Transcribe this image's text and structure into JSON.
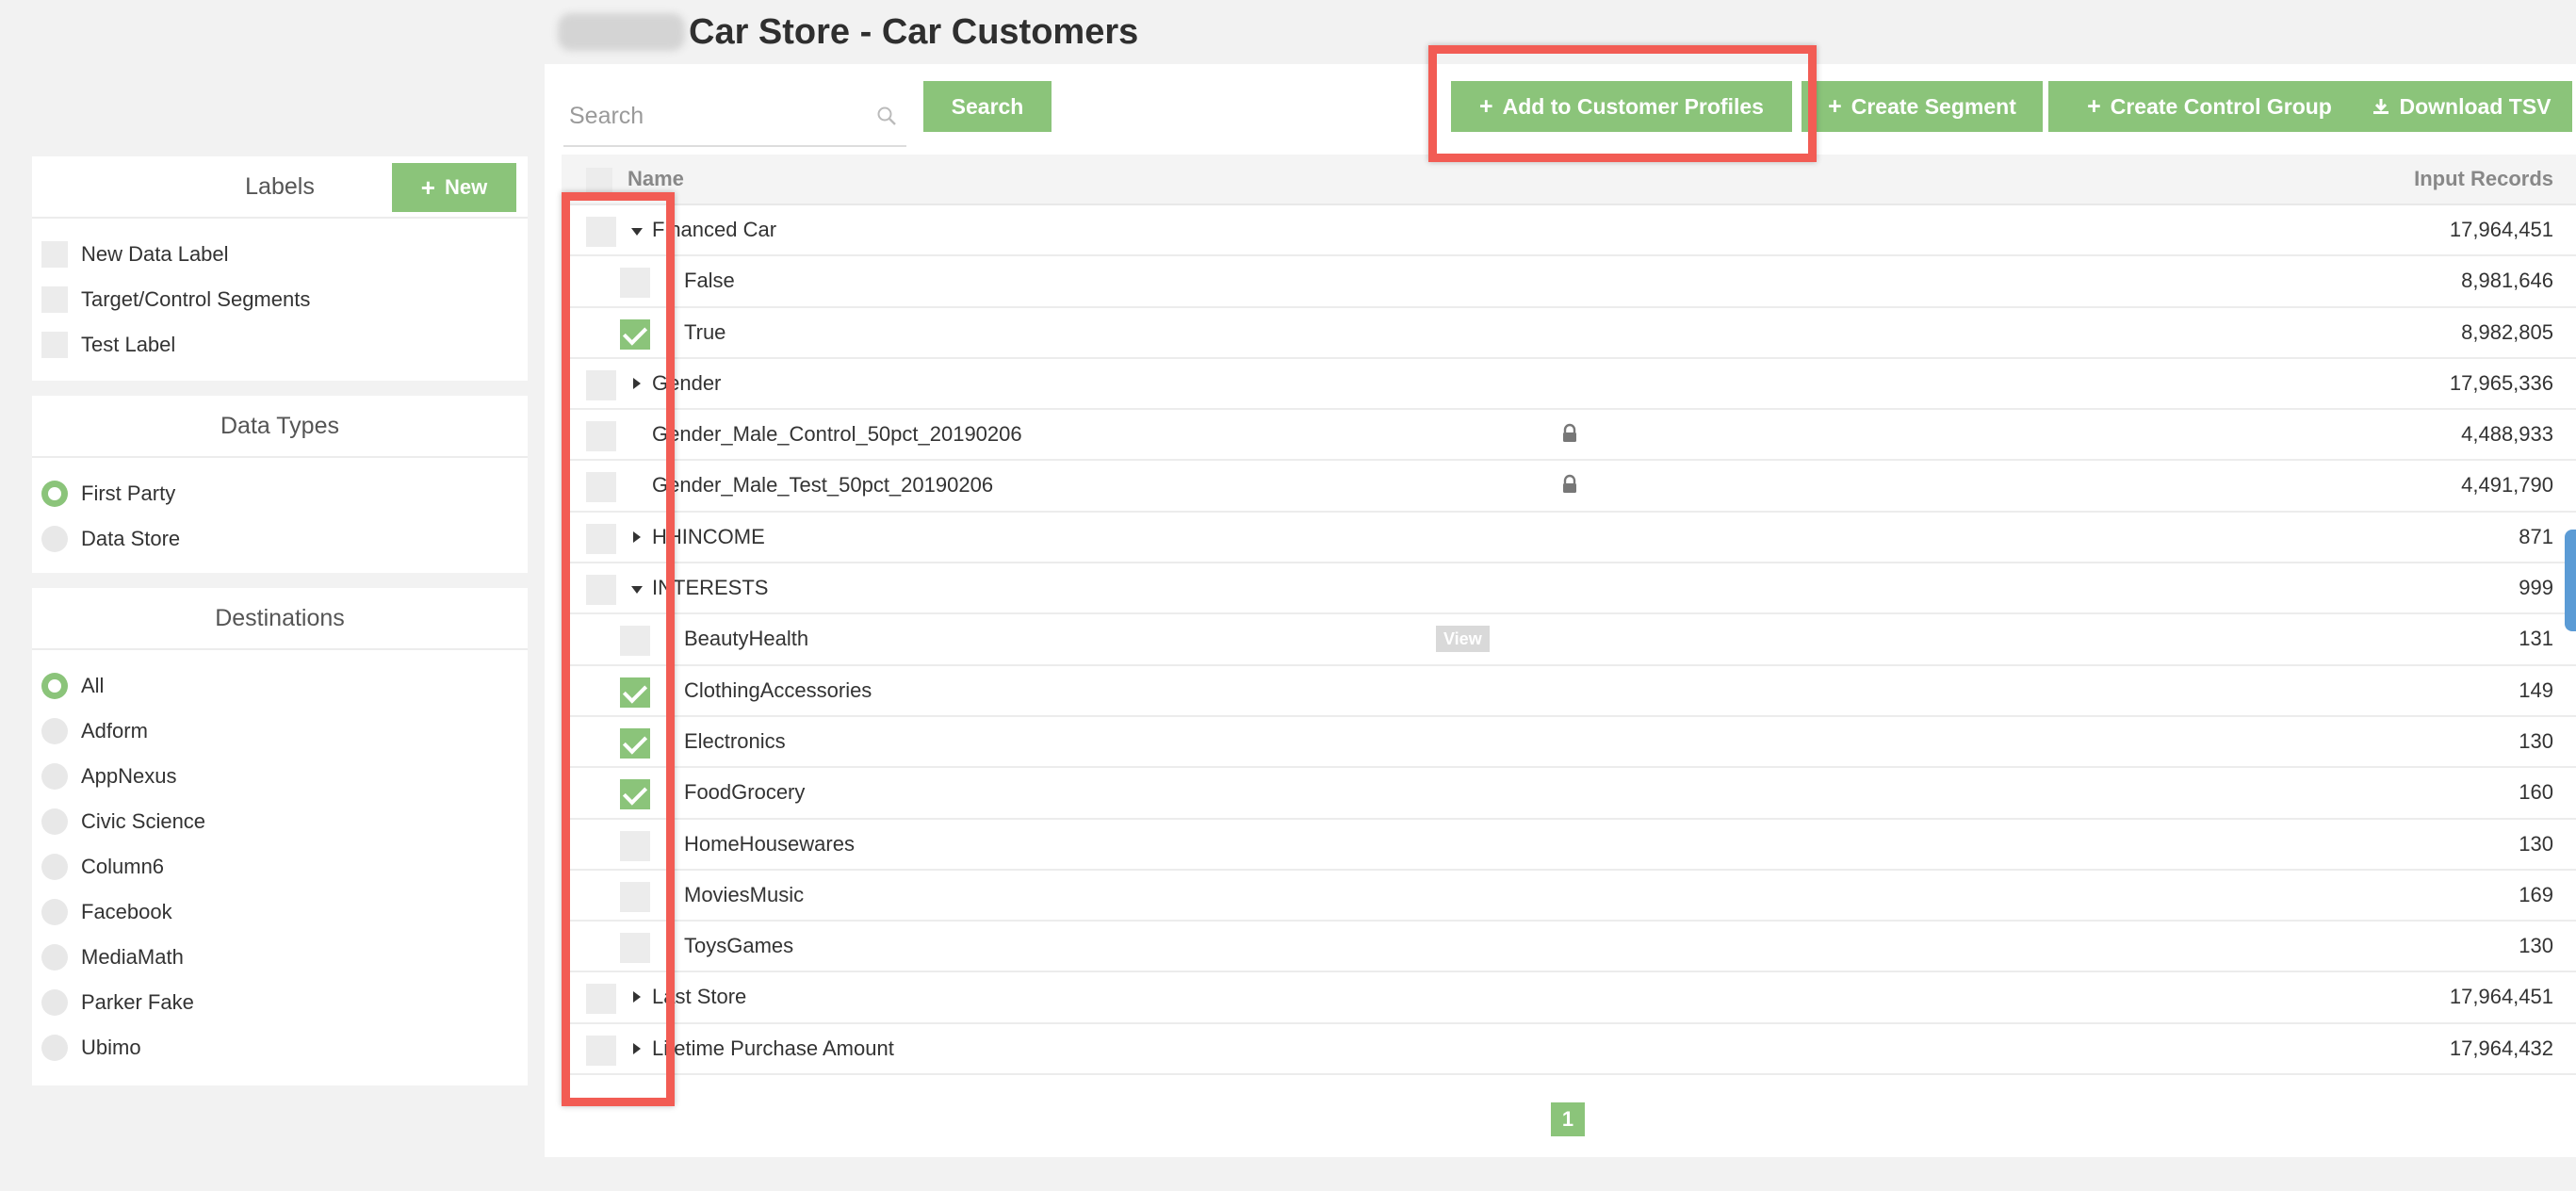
{
  "page": {
    "title": "Car Store - Car Customers"
  },
  "sidebar": {
    "labels": {
      "title": "Labels",
      "new_button": "New",
      "items": [
        {
          "label": "New Data Label",
          "checked": false
        },
        {
          "label": "Target/Control Segments",
          "checked": false
        },
        {
          "label": "Test Label",
          "checked": false
        }
      ]
    },
    "data_types": {
      "title": "Data Types",
      "items": [
        {
          "label": "First Party",
          "selected": true
        },
        {
          "label": "Data Store",
          "selected": false
        }
      ]
    },
    "destinations": {
      "title": "Destinations",
      "items": [
        {
          "label": "All",
          "selected": true
        },
        {
          "label": "Adform",
          "selected": false
        },
        {
          "label": "AppNexus",
          "selected": false
        },
        {
          "label": "Civic Science",
          "selected": false
        },
        {
          "label": "Column6",
          "selected": false
        },
        {
          "label": "Facebook",
          "selected": false
        },
        {
          "label": "MediaMath",
          "selected": false
        },
        {
          "label": "Parker Fake",
          "selected": false
        },
        {
          "label": "Ubimo",
          "selected": false
        }
      ]
    }
  },
  "toolbar": {
    "search_placeholder": "Search",
    "search_button": "Search",
    "add_button": "Add to Customer Profiles",
    "segment_button": "Create Segment",
    "control_button": "Create Control Group",
    "download_button": "Download TSV"
  },
  "table": {
    "col_name": "Name",
    "col_records": "Input Records",
    "rows": [
      {
        "name": "Financed Car",
        "level": 0,
        "expander": "down",
        "checked": false,
        "records": "17,964,451"
      },
      {
        "name": "False",
        "level": 1,
        "checked": false,
        "records": "8,981,646"
      },
      {
        "name": "True",
        "level": 1,
        "checked": true,
        "records": "8,982,805"
      },
      {
        "name": "Gender",
        "level": 0,
        "expander": "right",
        "checked": false,
        "records": "17,965,336"
      },
      {
        "name": "Gender_Male_Control_50pct_20190206",
        "level": 0,
        "checked": false,
        "records": "4,488,933",
        "locked": true
      },
      {
        "name": "Gender_Male_Test_50pct_20190206",
        "level": 0,
        "checked": false,
        "records": "4,491,790",
        "locked": true
      },
      {
        "name": "HHINCOME",
        "level": 0,
        "expander": "right",
        "checked": false,
        "records": "871"
      },
      {
        "name": "INTERESTS",
        "level": 0,
        "expander": "down",
        "checked": false,
        "records": "999"
      },
      {
        "name": "BeautyHealth",
        "level": 1,
        "checked": false,
        "records": "131",
        "badge": "View"
      },
      {
        "name": "ClothingAccessories",
        "level": 1,
        "checked": true,
        "records": "149"
      },
      {
        "name": "Electronics",
        "level": 1,
        "checked": true,
        "records": "130"
      },
      {
        "name": "FoodGrocery",
        "level": 1,
        "checked": true,
        "records": "160"
      },
      {
        "name": "HomeHousewares",
        "level": 1,
        "checked": false,
        "records": "130"
      },
      {
        "name": "MoviesMusic",
        "level": 1,
        "checked": false,
        "records": "169"
      },
      {
        "name": "ToysGames",
        "level": 1,
        "checked": false,
        "records": "130"
      },
      {
        "name": "Last Store",
        "level": 0,
        "expander": "right",
        "checked": false,
        "records": "17,964,451"
      },
      {
        "name": "Lifetime Purchase Amount",
        "level": 0,
        "expander": "right",
        "checked": false,
        "records": "17,964,432"
      }
    ]
  },
  "pagination": {
    "current_page": "1"
  },
  "colors": {
    "accent": "#8bc47a",
    "highlight": "#f25c54"
  }
}
